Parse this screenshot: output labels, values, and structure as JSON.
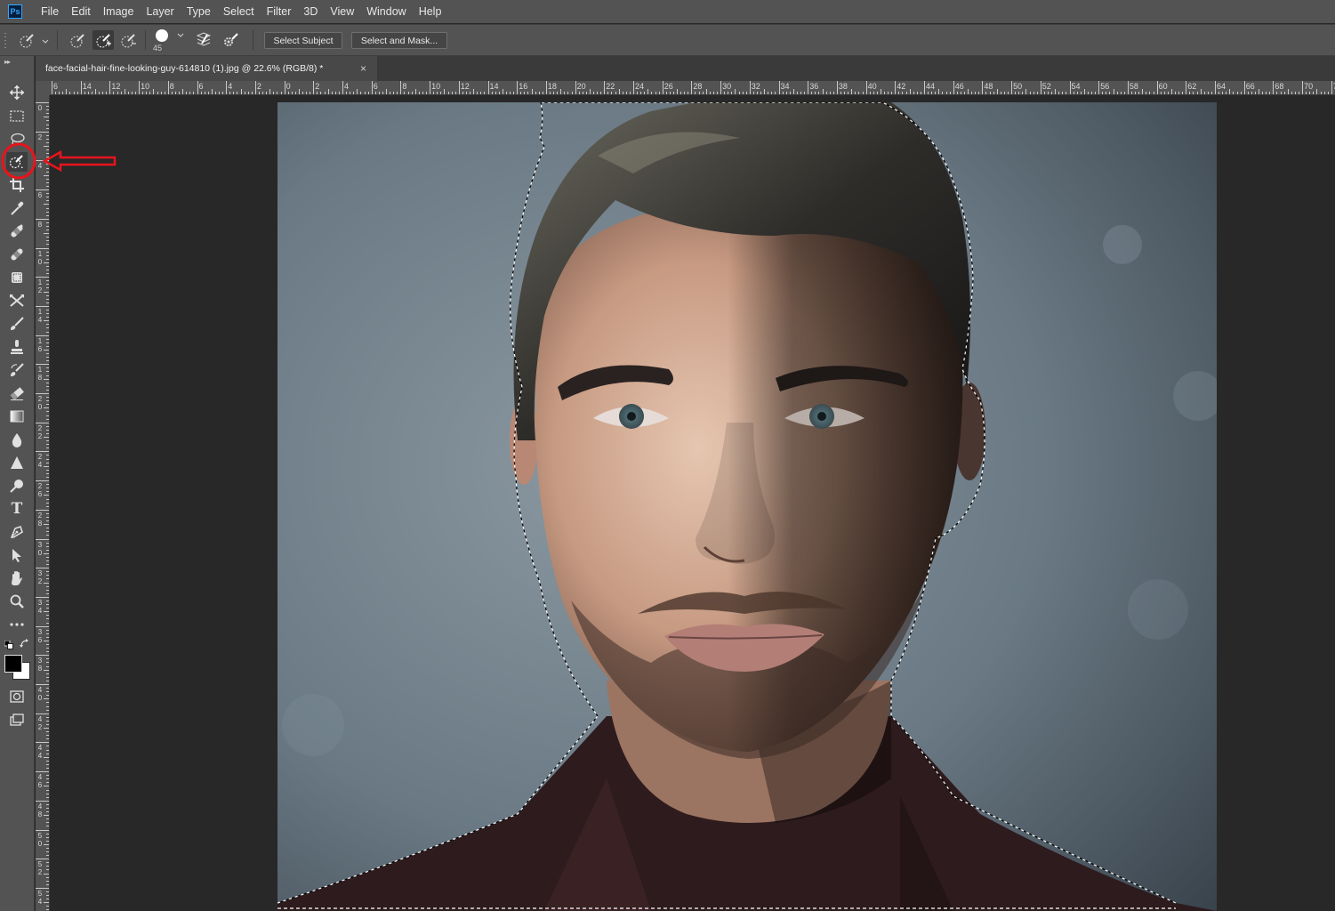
{
  "app": {
    "logo_text": "Ps"
  },
  "menu": [
    "File",
    "Edit",
    "Image",
    "Layer",
    "Type",
    "Select",
    "Filter",
    "3D",
    "View",
    "Window",
    "Help"
  ],
  "options_bar": {
    "brush_size": "45",
    "select_subject_label": "Select Subject",
    "select_and_mask_label": "Select and Mask..."
  },
  "document_tab": {
    "title": "face-facial-hair-fine-looking-guy-614810 (1).jpg @ 22.6% (RGB/8) *",
    "close_glyph": "×"
  },
  "rulers": {
    "horizontal_labels": [
      "6",
      "14",
      "12",
      "10",
      "8",
      "6",
      "4",
      "2",
      "0",
      "2",
      "4",
      "6",
      "8",
      "10",
      "12",
      "14",
      "16",
      "18",
      "20",
      "22",
      "24",
      "26",
      "28",
      "30",
      "32",
      "34",
      "36",
      "38",
      "40",
      "42",
      "44",
      "46",
      "48",
      "50",
      "52",
      "54",
      "56",
      "58",
      "60",
      "62",
      "64",
      "66",
      "68",
      "70",
      "72"
    ],
    "vertical_labels": [
      "0",
      "2",
      "4",
      "6",
      "8",
      "1 0",
      "1 2",
      "1 4",
      "1 6",
      "1 8",
      "2 0",
      "2 2",
      "2 4",
      "2 6",
      "2 8",
      "3 0",
      "3 2",
      "3 4",
      "3 6",
      "3 8",
      "4 0",
      "4 2",
      "4 4",
      "4 6",
      "4 8",
      "5 0",
      "5 2",
      "5 4"
    ]
  },
  "tools": [
    {
      "name": "move-tool",
      "icon": "move-icon"
    },
    {
      "name": "rectangular-marquee-tool",
      "icon": "marquee-icon"
    },
    {
      "name": "lasso-tool",
      "icon": "lasso-icon"
    },
    {
      "name": "quick-selection-tool",
      "icon": "quick-selection-icon",
      "active": true
    },
    {
      "name": "crop-tool",
      "icon": "crop-icon"
    },
    {
      "name": "eyedropper-tool",
      "icon": "eyedropper-icon"
    },
    {
      "name": "spot-healing-tool",
      "icon": "bandage-icon"
    },
    {
      "name": "healing-brush-tool",
      "icon": "bandage-icon"
    },
    {
      "name": "patch-tool",
      "icon": "patch-icon"
    },
    {
      "name": "content-aware-move-tool",
      "icon": "cross-arrows-icon"
    },
    {
      "name": "brush-tool",
      "icon": "brush-icon"
    },
    {
      "name": "clone-stamp-tool",
      "icon": "stamp-icon"
    },
    {
      "name": "history-brush-tool",
      "icon": "history-brush-icon"
    },
    {
      "name": "eraser-tool",
      "icon": "eraser-icon"
    },
    {
      "name": "gradient-tool",
      "icon": "gradient-icon"
    },
    {
      "name": "blur-tool",
      "icon": "drop-icon"
    },
    {
      "name": "sharpen-tool",
      "icon": "triangle-icon"
    },
    {
      "name": "dodge-tool",
      "icon": "dodge-icon"
    },
    {
      "name": "type-tool",
      "icon": "type-icon",
      "glyph": "T"
    },
    {
      "name": "pen-tool",
      "icon": "pen-icon"
    },
    {
      "name": "path-selection-tool",
      "icon": "arrow-cursor-icon"
    },
    {
      "name": "hand-tool",
      "icon": "hand-icon"
    },
    {
      "name": "zoom-tool",
      "icon": "zoom-icon"
    },
    {
      "name": "edit-toolbar",
      "icon": "more-icon"
    }
  ],
  "colors": {
    "foreground": "#000000",
    "background": "#ffffff",
    "annotation": "#e8141c",
    "ui_panel": "#535353",
    "canvas_bg": "#282828"
  }
}
